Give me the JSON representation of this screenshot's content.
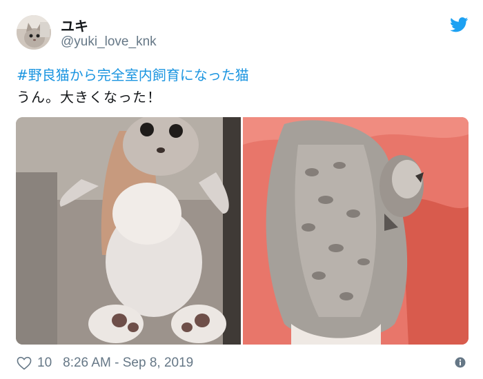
{
  "user": {
    "display_name": "ユキ",
    "handle": "@yuki_love_knk",
    "avatar_icon": "cat-avatar-icon"
  },
  "tweet": {
    "hashtag_line": "#野良猫から完全室内飼育になった猫",
    "text_line": "うん。大きくなった！"
  },
  "media": {
    "images": [
      "kitten-held-up-photo",
      "cat-sleeping-on-red-blanket-photo"
    ]
  },
  "footer": {
    "likes": "10",
    "timestamp": "8:26 AM - Sep 8, 2019"
  },
  "icons": {
    "brand": "twitter-bird-icon",
    "like": "heart-icon",
    "info": "info-icon"
  },
  "colors": {
    "link": "#1b95e0",
    "secondary_text": "#657786",
    "twitter_blue": "#1da1f2"
  }
}
